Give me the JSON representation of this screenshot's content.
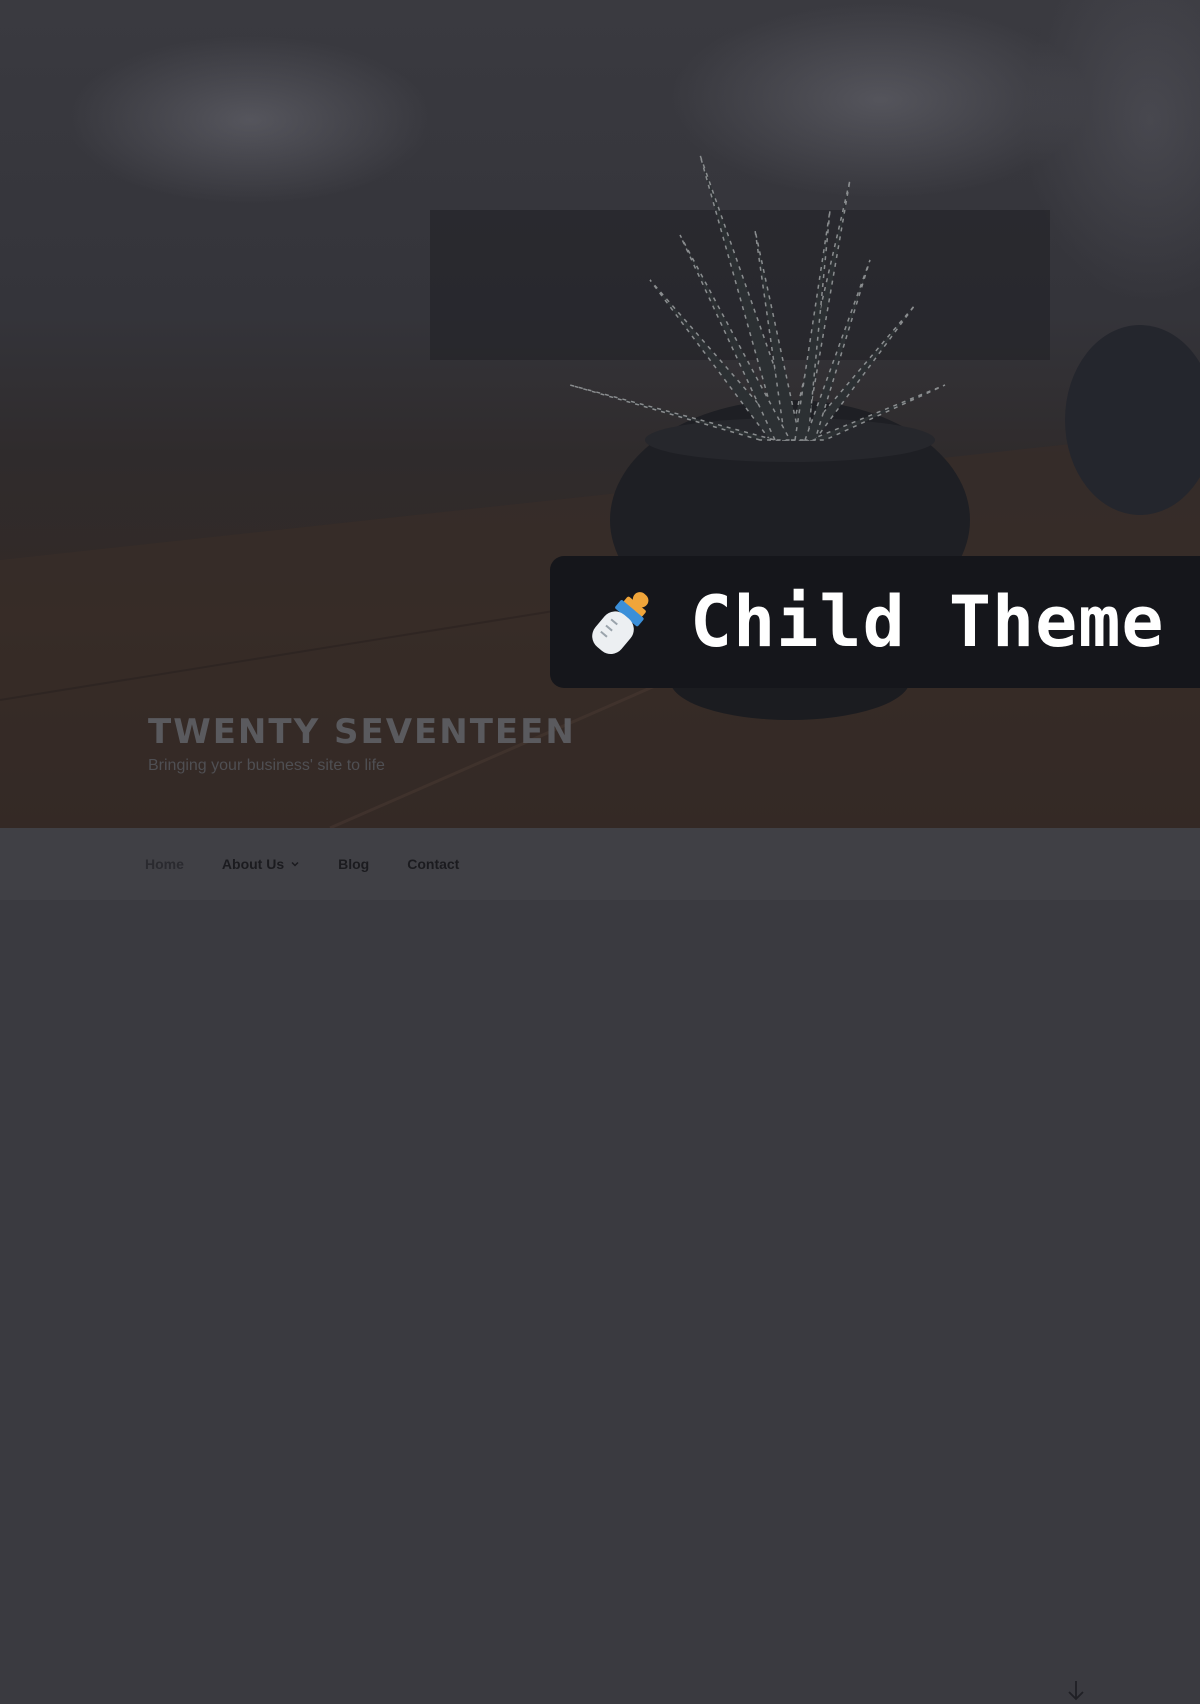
{
  "site": {
    "title": "TWENTY SEVENTEEN",
    "tagline": "Bringing your business' site to life"
  },
  "badge": {
    "icon": "baby-bottle-icon",
    "label": "Child Theme"
  },
  "nav": {
    "items": [
      {
        "label": "Home",
        "current": true
      },
      {
        "label": "About Us",
        "has_submenu": true
      },
      {
        "label": "Blog"
      },
      {
        "label": "Contact"
      }
    ],
    "scroll_icon": "arrow-down-icon"
  },
  "colors": {
    "badge_bg": "#15161b",
    "nav_bg": "#404045",
    "nav_text": "#1b1b1f"
  }
}
